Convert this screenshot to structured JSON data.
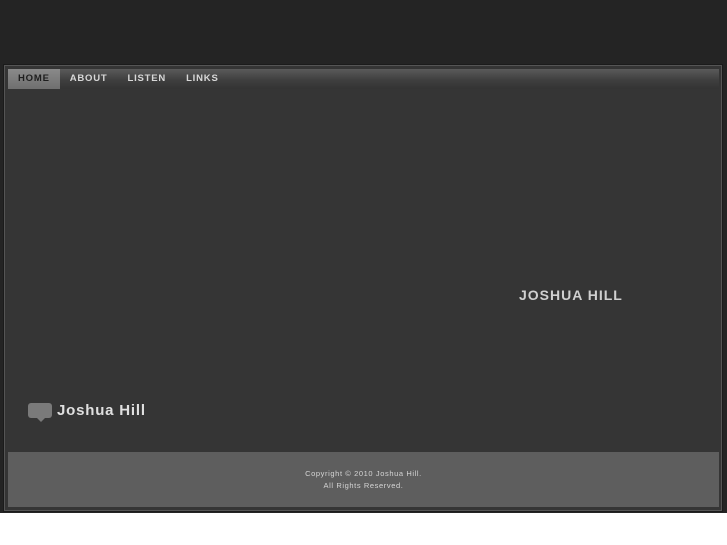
{
  "nav": {
    "items": [
      {
        "label": "HOME",
        "active": true
      },
      {
        "label": "ABOUT"
      },
      {
        "label": "LISTEN"
      },
      {
        "label": "LINKS"
      }
    ]
  },
  "main": {
    "title": "JOSHUA HILL"
  },
  "logo": {
    "icon": "speech-bubble-icon",
    "text": "Joshua Hill"
  },
  "footer": {
    "line1": "Copyright © 2010 Joshua Hill.",
    "line2": "All Rights Reserved."
  }
}
